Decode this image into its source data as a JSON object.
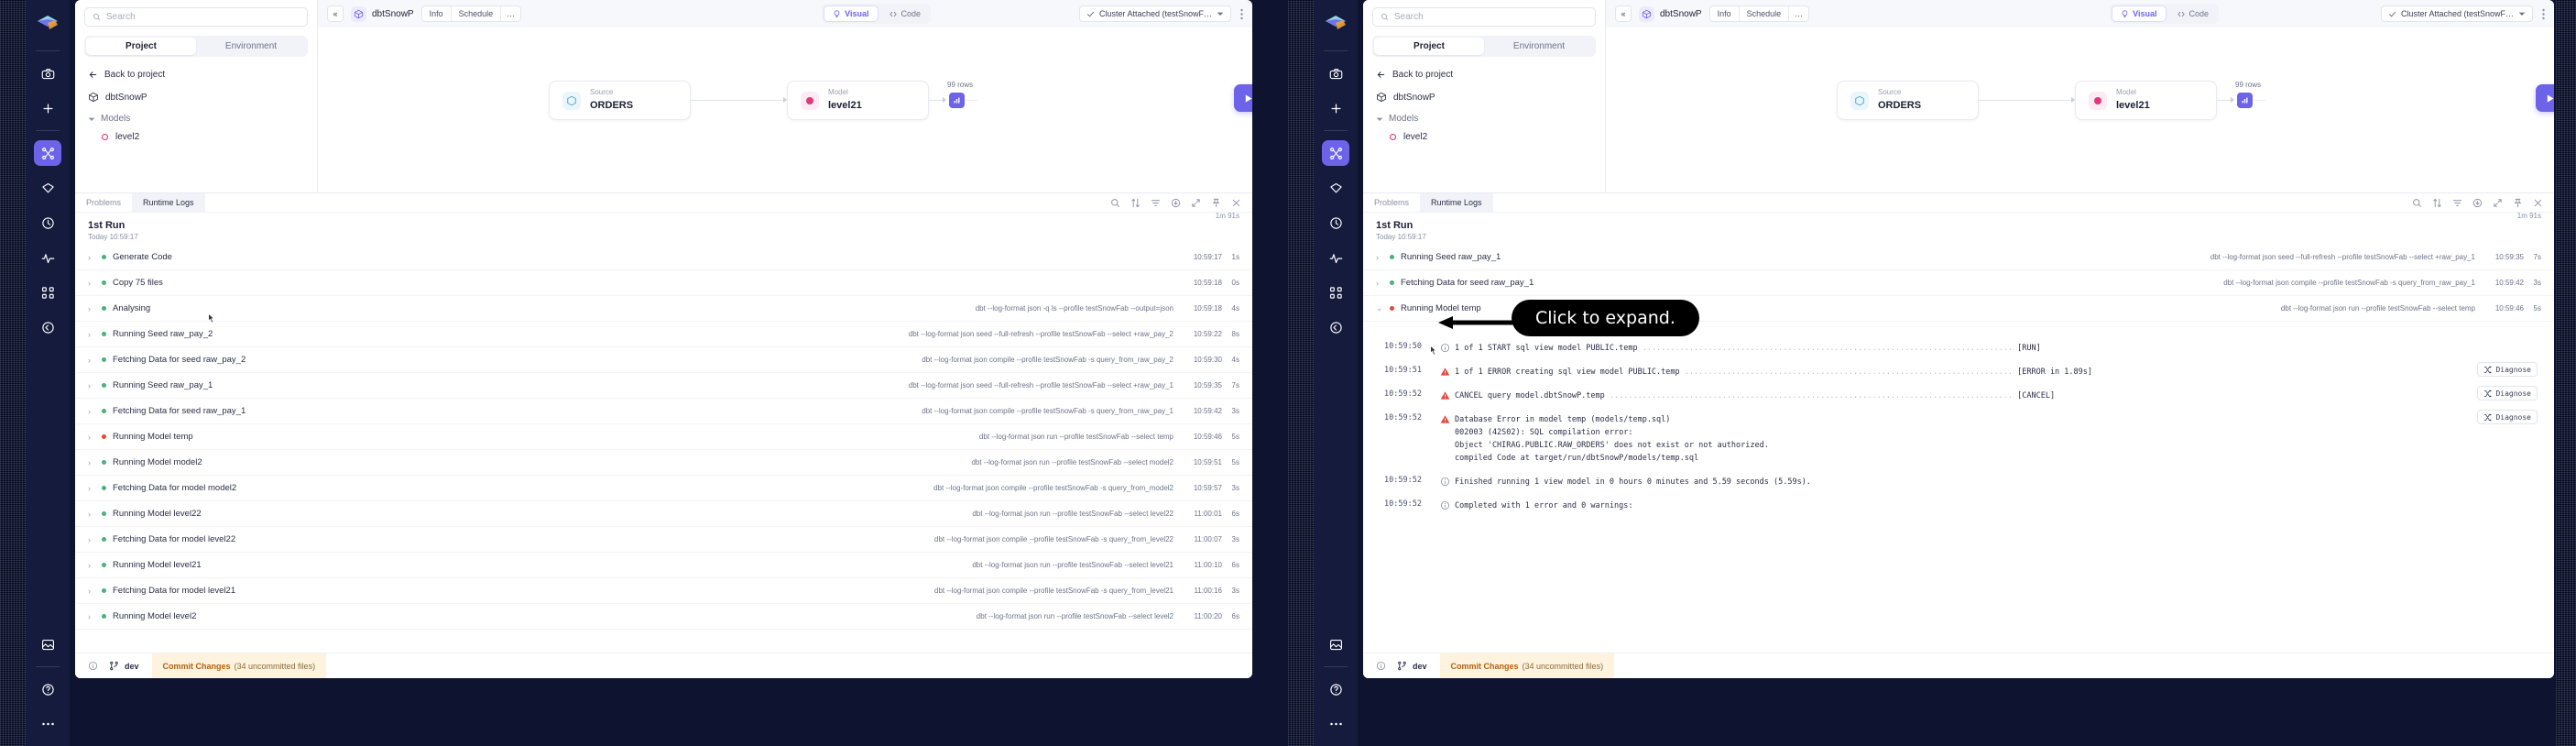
{
  "rail": {
    "items": [
      {
        "name": "app-logo",
        "icon": "logo-prism"
      },
      {
        "name": "camera-icon",
        "icon": "camera"
      },
      {
        "name": "add-icon",
        "icon": "plus"
      },
      {
        "name": "lineage-icon",
        "icon": "nodes"
      },
      {
        "name": "gem-icon",
        "icon": "diamond"
      },
      {
        "name": "history-icon",
        "icon": "clock"
      },
      {
        "name": "activity-icon",
        "icon": "pulse"
      },
      {
        "name": "workflow-icon",
        "icon": "flow"
      },
      {
        "name": "time-travel-icon",
        "icon": "rewind"
      },
      {
        "name": "gallery-icon",
        "icon": "image"
      },
      {
        "name": "help-icon",
        "icon": "question"
      },
      {
        "name": "more-icon",
        "icon": "ellipsis"
      }
    ]
  },
  "search": {
    "placeholder": "Search"
  },
  "segmented": {
    "project": "Project",
    "environment": "Environment",
    "active": "Project"
  },
  "explorer": {
    "back": "Back to project",
    "project_name": "dbtSnowP",
    "group": "Models",
    "leaf": "level2"
  },
  "topbar": {
    "collapse": "«",
    "breadcrumb": "dbtSnowP",
    "tabs": [
      "Info",
      "Schedule",
      "…"
    ],
    "visual": "Visual",
    "code": "Code",
    "cluster": "Cluster Attached (testSnowF…"
  },
  "canvas": {
    "source_node": {
      "kind": "Source",
      "name": "ORDERS"
    },
    "model_node": {
      "kind": "Model",
      "name": "level21"
    },
    "rows_badge": "99 rows",
    "run_label": "▶"
  },
  "logs": {
    "tabs": [
      {
        "label": "Problems",
        "active": false
      },
      {
        "label": "Runtime Logs",
        "active": true
      }
    ],
    "tools": [
      "search-icon",
      "sort-icon",
      "filter-icon",
      "download-icon",
      "expand-icon",
      "pin-icon",
      "close-icon"
    ],
    "run_title": "1st Run",
    "run_subtitle": "Today 10:59:17",
    "run_duration": "1m 91s"
  },
  "left_rows": [
    {
      "label": "Generate Code",
      "status": "ok",
      "cmd": "",
      "time": "10:59:17",
      "dur": "1s"
    },
    {
      "label": "Copy 75 files",
      "status": "ok",
      "cmd": "",
      "time": "10:59:18",
      "dur": "0s"
    },
    {
      "label": "Analysing",
      "status": "ok",
      "cmd": "dbt --log-format json -q ls --profile testSnowFab --output=json",
      "time": "10:59:18",
      "dur": "4s"
    },
    {
      "label": "Running Seed raw_pay_2",
      "status": "ok",
      "cmd": "dbt --log-format json seed --full-refresh --profile testSnowFab --select +raw_pay_2",
      "time": "10:59:22",
      "dur": "8s"
    },
    {
      "label": "Fetching Data for seed raw_pay_2",
      "status": "ok",
      "cmd": "dbt --log-format json compile --profile testSnowFab -s query_from_raw_pay_2",
      "time": "10:59:30",
      "dur": "4s"
    },
    {
      "label": "Running Seed raw_pay_1",
      "status": "ok",
      "cmd": "dbt --log-format json seed --full-refresh --profile testSnowFab --select +raw_pay_1",
      "time": "10:59:35",
      "dur": "7s"
    },
    {
      "label": "Fetching Data for seed raw_pay_1",
      "status": "ok",
      "cmd": "dbt --log-format json compile --profile testSnowFab -s query_from_raw_pay_1",
      "time": "10:59:42",
      "dur": "3s"
    },
    {
      "label": "Running Model temp",
      "status": "err",
      "cmd": "dbt --log-format json run --profile testSnowFab --select temp",
      "time": "10:59:46",
      "dur": "5s"
    },
    {
      "label": "Running Model model2",
      "status": "ok",
      "cmd": "dbt --log-format json run --profile testSnowFab --select model2",
      "time": "10:59:51",
      "dur": "5s"
    },
    {
      "label": "Fetching Data for model model2",
      "status": "ok",
      "cmd": "dbt --log-format json compile --profile testSnowFab -s query_from_model2",
      "time": "10:59:57",
      "dur": "3s"
    },
    {
      "label": "Running Model level22",
      "status": "ok",
      "cmd": "dbt --log-format json run --profile testSnowFab --select level22",
      "time": "11:00:01",
      "dur": "6s"
    },
    {
      "label": "Fetching Data for model level22",
      "status": "ok",
      "cmd": "dbt --log-format json compile --profile testSnowFab -s query_from_level22",
      "time": "11:00:07",
      "dur": "3s"
    },
    {
      "label": "Running Model level21",
      "status": "ok",
      "cmd": "dbt --log-format json run --profile testSnowFab --select level21",
      "time": "11:00:10",
      "dur": "6s"
    },
    {
      "label": "Fetching Data for model level21",
      "status": "ok",
      "cmd": "dbt --log-format json compile --profile testSnowFab -s query_from_level21",
      "time": "11:00:16",
      "dur": "3s"
    },
    {
      "label": "Running Model level2",
      "status": "ok",
      "cmd": "dbt --log-format json run --profile testSnowFab --select level2",
      "time": "11:00:20",
      "dur": "6s"
    }
  ],
  "right_rows": [
    {
      "label": "Running Seed raw_pay_1",
      "status": "ok",
      "cmd": "dbt --log-format json seed --full-refresh --profile testSnowFab --select +raw_pay_1",
      "time": "10:59:35",
      "dur": "7s"
    },
    {
      "label": "Fetching Data for seed raw_pay_1",
      "status": "ok",
      "cmd": "dbt --log-format json compile --profile testSnowFab -s query_from_raw_pay_1",
      "time": "10:59:42",
      "dur": "3s"
    },
    {
      "label": "Running Model temp",
      "status": "err",
      "cmd": "dbt --log-format json run --profile testSnowFab --select temp",
      "time": "10:59:46",
      "dur": "5s",
      "expanded": true
    }
  ],
  "detail_lines": [
    {
      "time": "10:59:50",
      "icon": "info",
      "text": "1 of 1 START sql view model PUBLIC.temp",
      "tag": "[RUN]",
      "diagnose": false
    },
    {
      "time": "10:59:51",
      "icon": "error",
      "text": "1 of 1 ERROR creating sql view model PUBLIC.temp",
      "tag": "[ERROR in 1.89s]",
      "diagnose": true
    },
    {
      "time": "10:59:52",
      "icon": "error",
      "text": "CANCEL query model.dbtSnowP.temp",
      "tag": "[CANCEL]",
      "diagnose": true
    },
    {
      "time": "10:59:52",
      "icon": "error",
      "text": "Database Error in model temp (models/temp.sql)",
      "tag": "",
      "diagnose": true,
      "extra": [
        "002003 (42S02): SQL compilation error:",
        "Object 'CHIRAG.PUBLIC.RAW_ORDERS' does not exist or not authorized.",
        "compiled Code at target/run/dbtSnowP/models/temp.sql"
      ]
    },
    {
      "time": "10:59:52",
      "icon": "info",
      "text": "Finished running 1 view model in 0 hours 0 minutes and 5.59 seconds (5.59s).",
      "tag": "",
      "diagnose": false
    },
    {
      "time": "10:59:52",
      "icon": "info",
      "text": "Completed with 1 error and 0 warnings:",
      "tag": "",
      "diagnose": false
    }
  ],
  "diagnose_label": "Diagnose",
  "status_bar": {
    "branch": "dev",
    "commit_label": "Commit Changes",
    "commit_detail": "(34 uncommitted files)"
  },
  "callout": {
    "text": "Click to expand."
  },
  "colors": {
    "accent": "#6c63e8",
    "error": "#e8443a",
    "ok": "#4caf7d",
    "rail_bg": "#141b3c",
    "page_bg": "#0e1430",
    "commit_bg": "#fdf3df"
  }
}
